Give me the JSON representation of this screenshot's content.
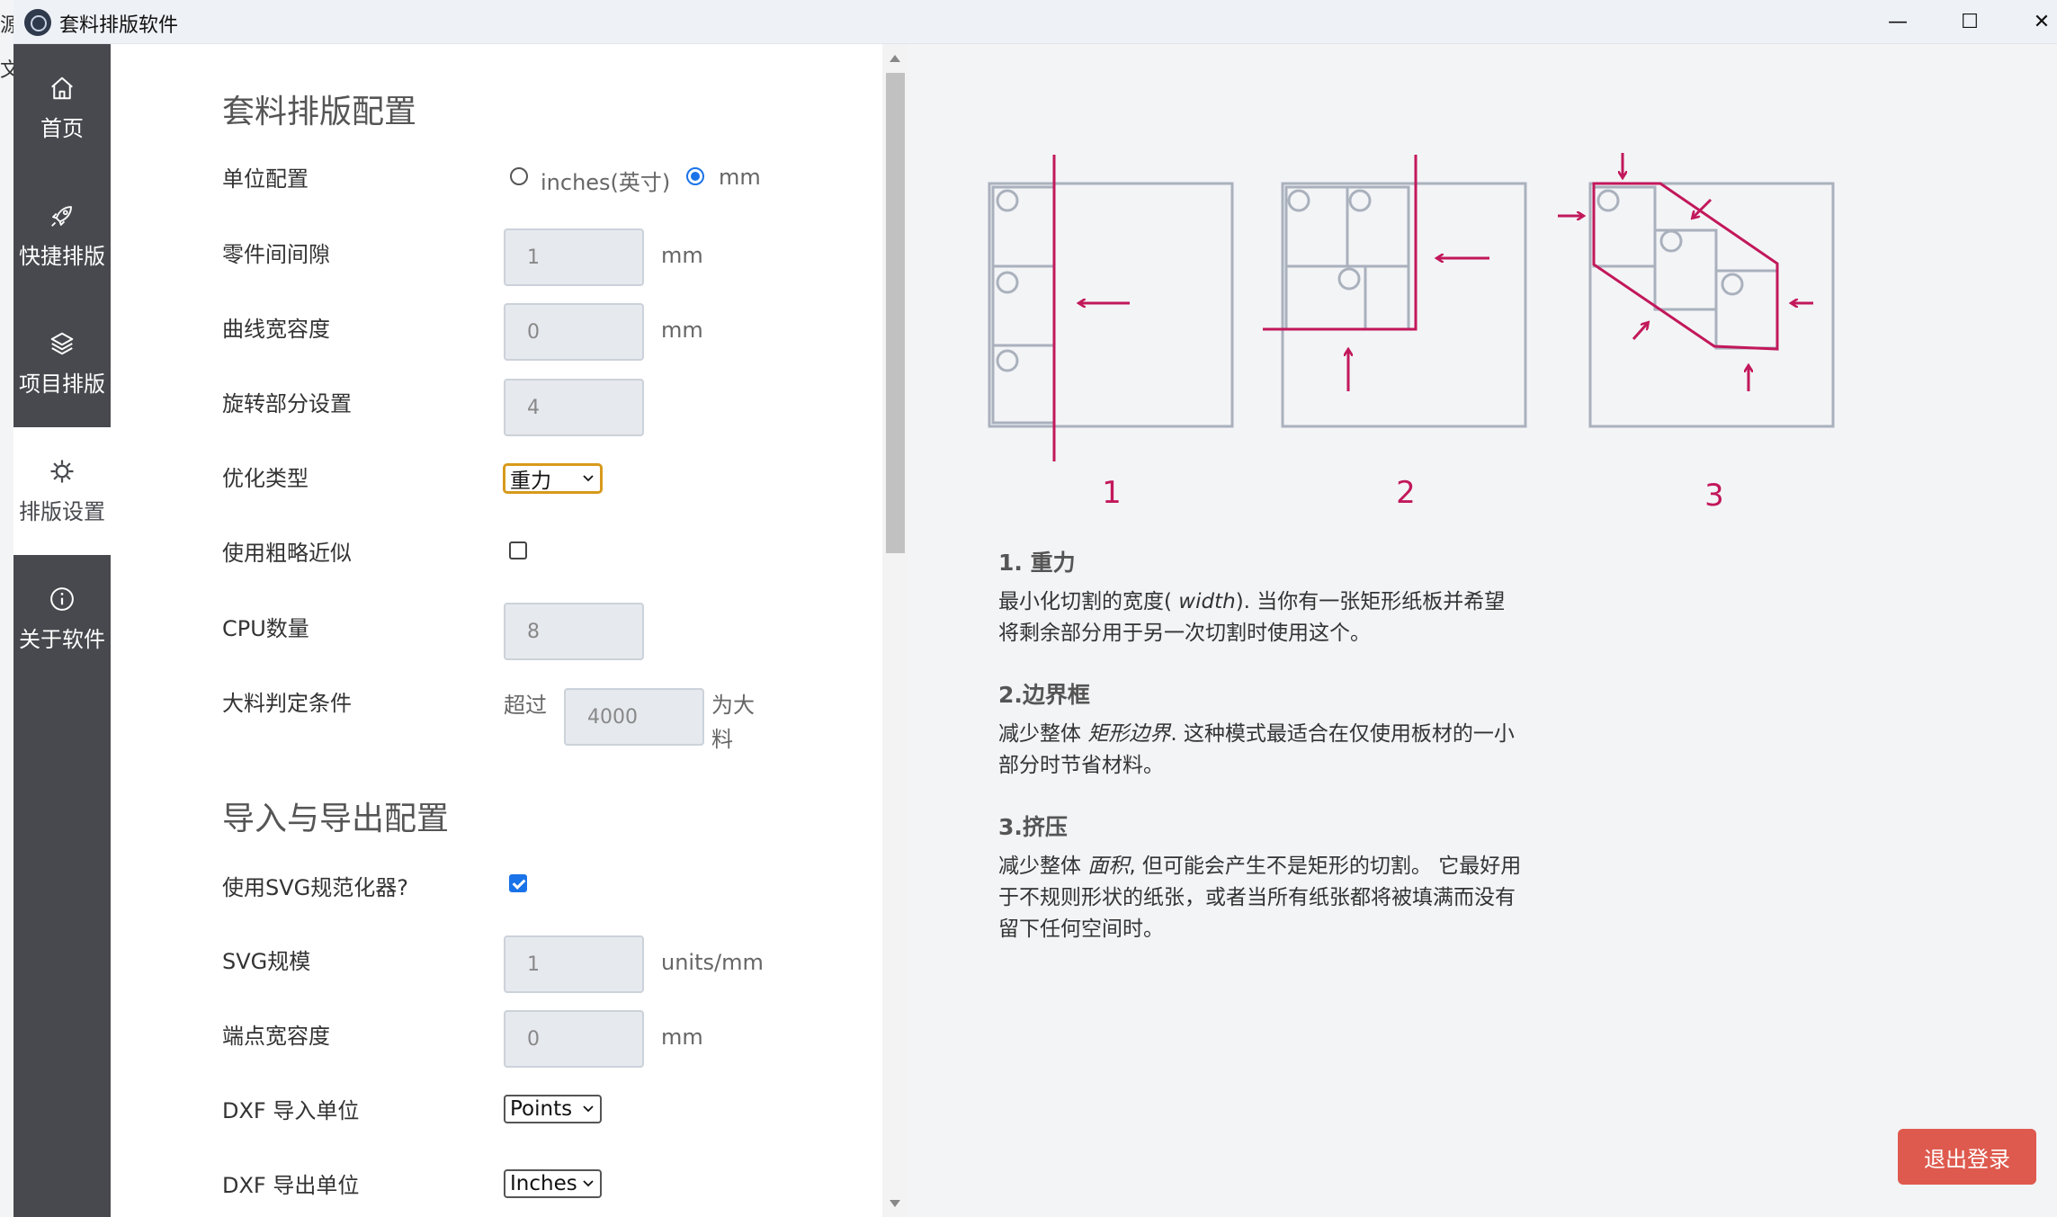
{
  "window": {
    "title": "套料排版软件",
    "controls": {
      "minimize": "—",
      "maximize": "☐",
      "close": "✕"
    }
  },
  "background_app": {
    "glyphs": [
      "源",
      "文"
    ]
  },
  "sidebar": {
    "items": [
      {
        "label": "首页",
        "icon": "home-icon",
        "active": false
      },
      {
        "label": "快捷排版",
        "icon": "rocket-icon",
        "active": false
      },
      {
        "label": "项目排版",
        "icon": "layers-icon",
        "active": false
      },
      {
        "label": "排版设置",
        "icon": "gear-icon",
        "active": true
      },
      {
        "label": "关于软件",
        "icon": "info-icon",
        "active": false
      }
    ]
  },
  "settings": {
    "section1_title": "套料排版配置",
    "units": {
      "label": "单位配置",
      "options": [
        "inches(英寸)",
        "mm"
      ],
      "selected": "mm"
    },
    "spacing": {
      "label": "零件间间隙",
      "value": "1",
      "unit": "mm"
    },
    "curve_tolerance": {
      "label": "曲线宽容度",
      "value": "0",
      "unit": "mm"
    },
    "rotations": {
      "label": "旋转部分设置",
      "value": "4"
    },
    "optimization": {
      "label": "优化类型",
      "selected": "重力"
    },
    "rough_approx": {
      "label": "使用粗略近似",
      "checked": false
    },
    "cpu": {
      "label": "CPU数量",
      "value": "8"
    },
    "large_part": {
      "label": "大料判定条件",
      "prefix": "超过",
      "value": "4000",
      "suffix_line1": "为大",
      "suffix_line2": "料"
    },
    "section2_title": "导入与导出配置",
    "svg_normalizer": {
      "label": "使用SVG规范化器?",
      "checked": true
    },
    "svg_scale": {
      "label": "SVG规模",
      "value": "1",
      "unit": "units/mm"
    },
    "endpoint_tolerance": {
      "label": "端点宽容度",
      "value": "0",
      "unit": "mm"
    },
    "dxf_import": {
      "label": "DXF 导入单位",
      "selected": "Points"
    },
    "dxf_export": {
      "label": "DXF 导出单位",
      "selected": "Inches"
    }
  },
  "info": {
    "figure_labels": [
      "1",
      "2",
      "3"
    ],
    "items": [
      {
        "title": "1. 重力",
        "text_before": "最小化切割的宽度( ",
        "em": "width",
        "text_after": "). 当你有一张矩形纸板并希望",
        "line2": "将剩余部分用于另一次切割时使用这个。"
      },
      {
        "title": "2.边界框",
        "text_before": "减少整体 ",
        "em": "矩形边界",
        "text_after": ". 这种模式最适合在仅使用板材的一小",
        "line2": "部分时节省材料。"
      },
      {
        "title": "3.挤压",
        "text_before": "减少整体 ",
        "em": "面积",
        "text_after": ", 但可能会产生不是矩形的切割。 它最好用",
        "line2": "于不规则形状的纸张，或者当所有纸张都将被填满而没有",
        "line3": "留下任何空间时。"
      }
    ],
    "logout_label": "退出登录"
  },
  "colors": {
    "sidebar_bg": "#48494e",
    "accent_red": "#c2185b",
    "diagram_gray": "#aab1bd",
    "logout_bg": "#de5a4e",
    "checked_blue": "#1a73e8"
  }
}
